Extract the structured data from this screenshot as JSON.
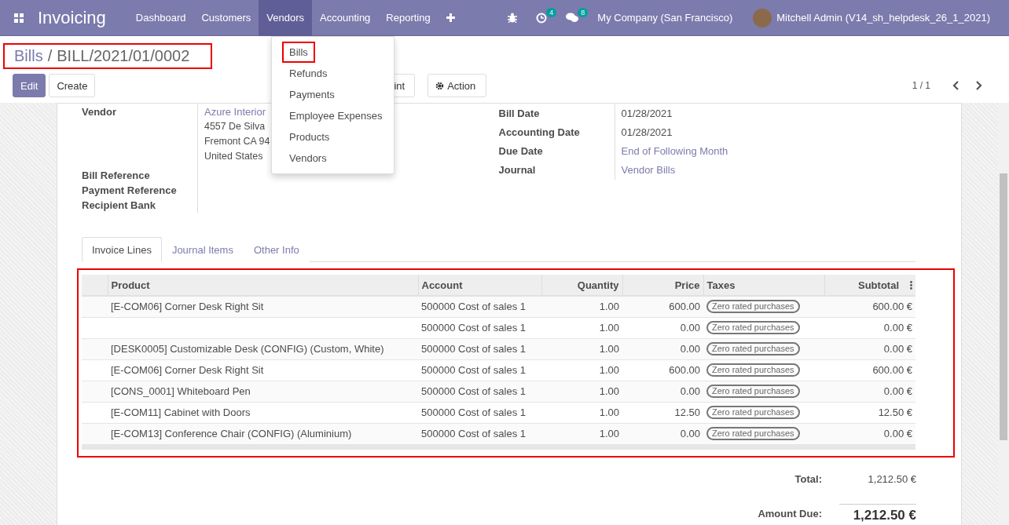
{
  "navbar": {
    "app_name": "Invoicing",
    "menu": [
      {
        "label": "Dashboard",
        "selected": false
      },
      {
        "label": "Customers",
        "selected": false
      },
      {
        "label": "Vendors",
        "selected": true
      },
      {
        "label": "Accounting",
        "selected": false
      },
      {
        "label": "Reporting",
        "selected": false
      }
    ],
    "activity_count": "4",
    "message_count": "8",
    "company": "My Company (San Francisco)",
    "user": "Mitchell Admin (V14_sh_helpdesk_26_1_2021)"
  },
  "dropdown": {
    "items": [
      {
        "label": "Bills",
        "annotated": true
      },
      {
        "label": "Refunds",
        "annotated": false
      },
      {
        "label": "Payments",
        "annotated": false
      },
      {
        "label": "Employee Expenses",
        "annotated": false
      },
      {
        "label": "Products",
        "annotated": false
      },
      {
        "label": "Vendors",
        "annotated": false
      }
    ]
  },
  "breadcrumb": {
    "parent": "Bills",
    "separator": "/",
    "current": "BILL/2021/01/0002",
    "annotated": true
  },
  "buttons": {
    "edit": "Edit",
    "create": "Create",
    "print_visible": "int",
    "action": "Action"
  },
  "pager": "1 / 1",
  "vendor": {
    "label": "Vendor",
    "name": "Azure Interior",
    "address": [
      "4557 De Silva",
      "Fremont CA 94",
      "United States"
    ]
  },
  "left_labels": [
    "Bill Reference",
    "Payment Reference",
    "Recipient Bank"
  ],
  "right_fields": [
    {
      "label": "Bill Date",
      "value": "01/28/2021",
      "link": false
    },
    {
      "label": "Accounting Date",
      "value": "01/28/2021",
      "link": false
    },
    {
      "label": "Due Date",
      "value": "End of Following Month",
      "link": true
    },
    {
      "label": "Journal",
      "value": "Vendor Bills",
      "link": true
    }
  ],
  "tabs": [
    {
      "label": "Invoice Lines",
      "selected": true
    },
    {
      "label": "Journal Items",
      "selected": false
    },
    {
      "label": "Other Info",
      "selected": false
    }
  ],
  "table": {
    "annotated": true,
    "columns": [
      "Product",
      "Account",
      "Quantity",
      "Price",
      "Taxes",
      "Subtotal"
    ],
    "rows": [
      {
        "product": "[E-COM06] Corner Desk Right Sit",
        "account": "500000 Cost of sales 1",
        "quantity": "1.00",
        "price": "600.00",
        "tax": "Zero rated purchases",
        "subtotal": "600.00 €"
      },
      {
        "account": "500000 Cost of sales 1",
        "quantity": "1.00",
        "price": "0.00",
        "tax": "Zero rated purchases",
        "subtotal": "0.00 €"
      },
      {
        "product": "[DESK0005] Customizable Desk (CONFIG) (Custom, White)",
        "account": "500000 Cost of sales 1",
        "quantity": "1.00",
        "price": "0.00",
        "tax": "Zero rated purchases",
        "subtotal": "0.00 €"
      },
      {
        "product": "[E-COM06] Corner Desk Right Sit",
        "account": "500000 Cost of sales 1",
        "quantity": "1.00",
        "price": "600.00",
        "tax": "Zero rated purchases",
        "subtotal": "600.00 €"
      },
      {
        "product": "[CONS_0001] Whiteboard Pen",
        "account": "500000 Cost of sales 1",
        "quantity": "1.00",
        "price": "0.00",
        "tax": "Zero rated purchases",
        "subtotal": "0.00 €"
      },
      {
        "product": "[E-COM11] Cabinet with Doors",
        "account": "500000 Cost of sales 1",
        "quantity": "1.00",
        "price": "12.50",
        "tax": "Zero rated purchases",
        "subtotal": "12.50 €"
      },
      {
        "product": "[E-COM13] Conference Chair (CONFIG) (Aluminium)",
        "account": "500000 Cost of sales 1",
        "quantity": "1.00",
        "price": "0.00",
        "tax": "Zero rated purchases",
        "subtotal": "0.00 €"
      }
    ]
  },
  "totals": [
    {
      "label": "Total:",
      "value": "1,212.50 €",
      "kind": "plain"
    },
    {
      "label": "Amount Due:",
      "value": "1,212.50 €",
      "kind": "due"
    }
  ]
}
